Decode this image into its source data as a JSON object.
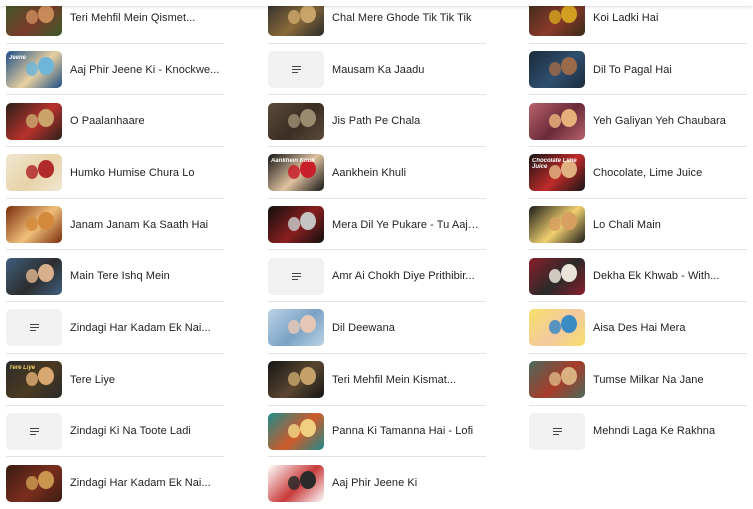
{
  "columns": [
    {
      "items": [
        {
          "title": "Teri Mehfil Mein Qismet...",
          "thumb": {
            "kind": "image",
            "colors": [
              "#3a5a2a",
              "#c98a5a",
              "#7a3b2b"
            ]
          }
        },
        {
          "title": "Aaj Phir Jeene Ki - Knockwe...",
          "thumb": {
            "kind": "image",
            "colors": [
              "#1c4e86",
              "#6db5d9",
              "#e8d0a0"
            ],
            "caption": "Jeene",
            "caption_color": "#ffffff"
          }
        },
        {
          "title": "O Paalanhaare",
          "thumb": {
            "kind": "image",
            "colors": [
              "#2a1f1a",
              "#caa36b",
              "#b8322c"
            ],
            "caption": "",
            "caption_color": "#ffffff"
          }
        },
        {
          "title": "Humko Humise Chura Lo",
          "thumb": {
            "kind": "image",
            "colors": [
              "#efe6d2",
              "#b12a2a",
              "#e8d3a8"
            ]
          }
        },
        {
          "title": "Janam Janam Ka Saath Hai",
          "thumb": {
            "kind": "image",
            "colors": [
              "#7a2c0c",
              "#d4883a",
              "#f0c07a"
            ]
          }
        },
        {
          "title": "Main Tere Ishq Mein",
          "thumb": {
            "kind": "image",
            "colors": [
              "#3e5f80",
              "#d9b08c",
              "#2d2d2d"
            ]
          }
        },
        {
          "title": "Zindagi Har Kadam Ek Nai...",
          "thumb": {
            "kind": "placeholder"
          }
        },
        {
          "title": "Tere Liye",
          "thumb": {
            "kind": "image",
            "colors": [
              "#2b2b2b",
              "#d9a870",
              "#4a3a20"
            ],
            "caption": "Tere Liye",
            "caption_color": "#f6d66a"
          }
        },
        {
          "title": "Zindagi Ki Na Toote Ladi",
          "thumb": {
            "kind": "placeholder"
          }
        },
        {
          "title": "Zindagi Har Kadam Ek Nai...",
          "thumb": {
            "kind": "image",
            "colors": [
              "#3a1c12",
              "#c9964f",
              "#7a2e1d"
            ],
            "caption": "",
            "caption_color": "#f2c94c"
          }
        }
      ]
    },
    {
      "items": [
        {
          "title": "Chal Mere Ghode Tik Tik Tik",
          "thumb": {
            "kind": "image",
            "colors": [
              "#2b2b2b",
              "#c9a46a",
              "#8a6a3a"
            ],
            "caption": "",
            "caption_color": "#ffffff"
          }
        },
        {
          "title": "Mausam Ka Jaadu",
          "thumb": {
            "kind": "placeholder"
          }
        },
        {
          "title": "Jis Path Pe Chala",
          "thumb": {
            "kind": "image",
            "colors": [
              "#5a4a3a",
              "#9a8a70",
              "#3b2e22"
            ]
          }
        },
        {
          "title": "Aankhein Khuli",
          "thumb": {
            "kind": "image",
            "colors": [
              "#151515",
              "#c8202a",
              "#e0c2a0"
            ],
            "caption": "Aankhein Khuli",
            "caption_color": "#ffffff"
          }
        },
        {
          "title": "Mera Dil Ye Pukare - Tu Aaja...",
          "thumb": {
            "kind": "image",
            "colors": [
              "#101010",
              "#c4c4c4",
              "#8a1e1e"
            ],
            "caption": "",
            "caption_color": "#ffffff"
          }
        },
        {
          "title": "Amr Ai Chokh Diye Prithibir...",
          "thumb": {
            "kind": "placeholder"
          }
        },
        {
          "title": "Dil Deewana",
          "thumb": {
            "kind": "image",
            "colors": [
              "#bcd3e6",
              "#e6c7b6",
              "#7aa2c4"
            ]
          }
        },
        {
          "title": "Teri Mehfil Mein Kismat...",
          "thumb": {
            "kind": "image",
            "colors": [
              "#151515",
              "#c3a168",
              "#5a4630"
            ],
            "caption": "",
            "caption_color": "#e8c56a"
          }
        },
        {
          "title": "Panna Ki Tamanna Hai - Lofi",
          "thumb": {
            "kind": "image",
            "colors": [
              "#1e8a8a",
              "#f0d080",
              "#d05a2a"
            ],
            "caption": "",
            "caption_color": "#ffffff"
          }
        },
        {
          "title": "Aaj Phir Jeene Ki",
          "thumb": {
            "kind": "image",
            "colors": [
              "#ffffff",
              "#2a2a2a",
              "#c83a3a"
            ],
            "caption": "",
            "caption_color": "#222222"
          }
        }
      ]
    },
    {
      "items": [
        {
          "title": "Koi Ladki Hai",
          "thumb": {
            "kind": "image",
            "colors": [
              "#3a2a1a",
              "#d1a020",
              "#8a3a2a"
            ],
            "caption": "",
            "caption_color": "#f5d24a"
          }
        },
        {
          "title": "Dil To Pagal Hai",
          "thumb": {
            "kind": "image",
            "colors": [
              "#1a2a3a",
              "#9a6a4a",
              "#2f4f6f"
            ]
          }
        },
        {
          "title": "Yeh Galiyan Yeh Chaubara",
          "thumb": {
            "kind": "image",
            "colors": [
              "#b8626a",
              "#e6b07a",
              "#6a2a3a"
            ]
          }
        },
        {
          "title": "Chocolate, Lime Juice",
          "thumb": {
            "kind": "image",
            "colors": [
              "#151515",
              "#e0b080",
              "#c02a2a"
            ],
            "caption": "Chocolate Lime Juice",
            "caption_color": "#ffffff"
          }
        },
        {
          "title": "Lo Chali Main",
          "thumb": {
            "kind": "image",
            "colors": [
              "#1a1a1a",
              "#d8a060",
              "#f1d070"
            ],
            "caption": "",
            "caption_color": "#f2c94c"
          }
        },
        {
          "title": "Dekha Ek Khwab - With...",
          "thumb": {
            "kind": "image",
            "colors": [
              "#8a1e2a",
              "#e9e4da",
              "#2a2a2a"
            ]
          }
        },
        {
          "title": "Aisa Des Hai Mera",
          "thumb": {
            "kind": "image",
            "colors": [
              "#f7e06a",
              "#3a8ac4",
              "#f3c8a0"
            ],
            "caption": "",
            "caption_color": "#2a6fb0"
          }
        },
        {
          "title": "Tumse Milkar Na Jane",
          "thumb": {
            "kind": "image",
            "colors": [
              "#4a6a5a",
              "#d9b080",
              "#a83a2a"
            ]
          }
        },
        {
          "title": "Mehndi Laga Ke Rakhna",
          "thumb": {
            "kind": "placeholder"
          }
        }
      ]
    }
  ]
}
